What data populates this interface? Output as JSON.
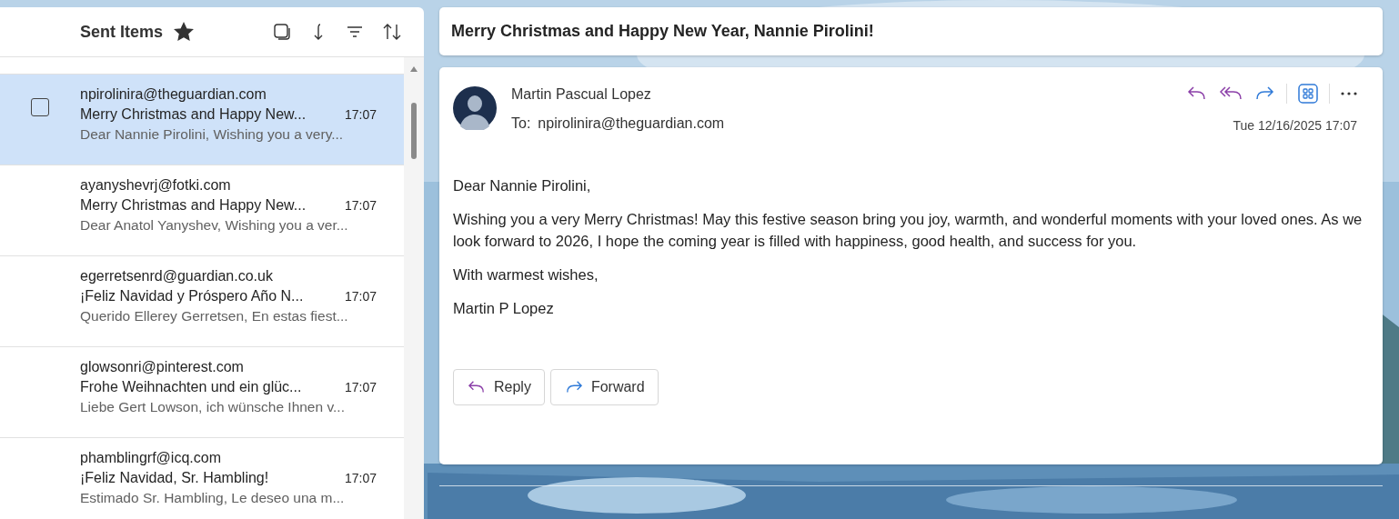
{
  "folder": {
    "title": "Sent Items",
    "favorite": true
  },
  "messages": [
    {
      "sender": "npirolinira@theguardian.com",
      "subject": "Merry Christmas and Happy New...",
      "time": "17:07",
      "preview": "Dear Nannie Pirolini, Wishing you a very...",
      "selected": true
    },
    {
      "sender": "ayanyshevrj@fotki.com",
      "subject": "Merry Christmas and Happy New...",
      "time": "17:07",
      "preview": "Dear Anatol Yanyshev, Wishing you a ver...",
      "selected": false
    },
    {
      "sender": "egerretsenrd@guardian.co.uk",
      "subject": "¡Feliz Navidad y Próspero Año N...",
      "time": "17:07",
      "preview": "Querido Ellerey Gerretsen, En estas fiest...",
      "selected": false
    },
    {
      "sender": "glowsonri@pinterest.com",
      "subject": "Frohe Weihnachten und ein glüc...",
      "time": "17:07",
      "preview": "Liebe Gert Lowson, ich wünsche Ihnen v...",
      "selected": false
    },
    {
      "sender": "phamblingrf@icq.com",
      "subject": "¡Feliz Navidad, Sr. Hambling!",
      "time": "17:07",
      "preview": "Estimado Sr. Hambling, Le deseo una m...",
      "selected": false
    }
  ],
  "reading": {
    "subject": "Merry Christmas and Happy New Year, Nannie Pirolini!",
    "from": "Martin Pascual Lopez",
    "to_label": "To:",
    "to": "npirolinira@theguardian.com",
    "date": "Tue 12/16/2025 17:07",
    "body": [
      "Dear Nannie Pirolini,",
      "Wishing you a very Merry Christmas! May this festive season bring you joy, warmth, and wonderful moments with your loved ones. As we look forward to 2026, I hope the coming year is filled with happiness, good health, and success for you.",
      "With warmest wishes,",
      "Martin P Lopez"
    ],
    "buttons": [
      {
        "kind": "reply",
        "label": "Reply"
      },
      {
        "kind": "forward",
        "label": "Forward"
      }
    ]
  }
}
